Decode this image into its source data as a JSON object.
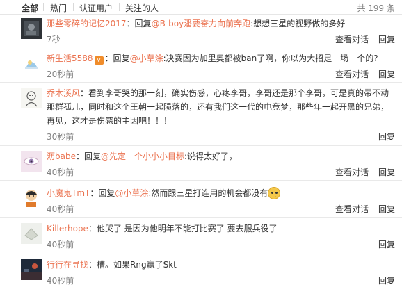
{
  "tabs": [
    {
      "label": "全部",
      "active": true
    },
    {
      "label": "热门",
      "active": false
    },
    {
      "label": "认证用户",
      "active": false
    },
    {
      "label": "关注的人",
      "active": false
    }
  ],
  "total": "共 199 条",
  "actions": {
    "view_conversation": "查看对话",
    "reply": "回复"
  },
  "comments": [
    {
      "user": "那些零碎的记忆2017",
      "prefix": "：回复",
      "mention": "@B-boy潘要奋力向前奔跑",
      "text": ":想想三星的视野做的多好",
      "time": "7秒"
    },
    {
      "user": "新生活5588",
      "prefix": "：回复",
      "mention": "@小草涂",
      "text": ":决赛因为加里奥都被ban了啊，你以为大招是一场一个的?",
      "time": "20秒前"
    },
    {
      "user": "乔木溪风",
      "text": "：看到李哥哭的那一刻，确实伤感，心疼李哥，李哥还是那个李哥，可是真的带不动那群孤儿，同时和这个王朝一起陨落的，还有我们这一代的电竞梦，那些年一起开黑的兄弟，再见，这才是伤感的主因吧！！！",
      "time": "30秒前"
    },
    {
      "user": "沥babe",
      "prefix": "：回复",
      "mention": "@先定一个小小小目标",
      "text": ":说得太好了，",
      "time": "40秒前"
    },
    {
      "user": "小魔鬼TmT",
      "prefix": "：回复",
      "mention": "@小草涂",
      "text": ":然而跟三星打连用的机会都没有",
      "time": "40秒前"
    },
    {
      "user": "Killerhope",
      "text": "：他哭了 是因为他明年不能打比赛了 要去服兵役了",
      "time": "40秒前"
    },
    {
      "user": "行行在寻找",
      "text": "：槽。如果Rng赢了Skt",
      "time": "40秒前"
    }
  ]
}
